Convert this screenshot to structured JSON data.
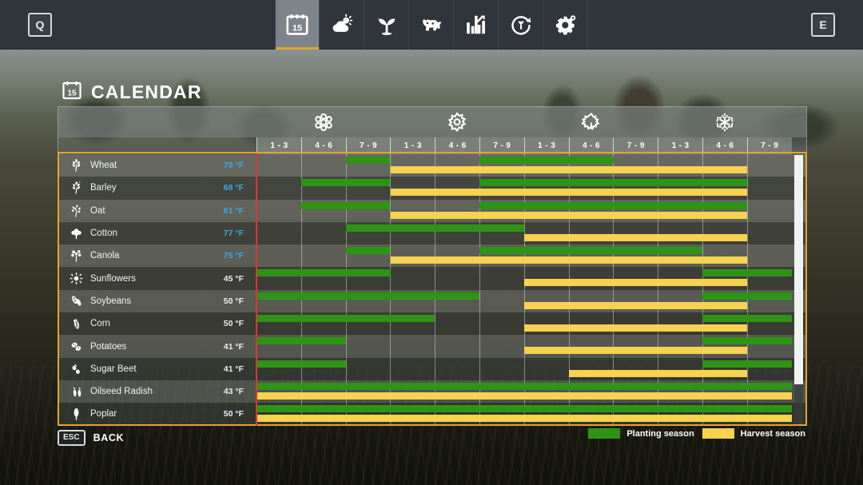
{
  "topbar": {
    "left_key": "Q",
    "right_key": "E",
    "nav": [
      {
        "label": "Calendar",
        "icon": "calendar-icon",
        "active": true
      },
      {
        "label": "Weather",
        "icon": "weather-icon",
        "active": false
      },
      {
        "label": "Crops",
        "icon": "sprout-icon",
        "active": false
      },
      {
        "label": "Animals",
        "icon": "cow-icon",
        "active": false
      },
      {
        "label": "Statistics",
        "icon": "bar-chart-icon",
        "active": false
      },
      {
        "label": "Production",
        "icon": "cycle-icon",
        "active": false
      },
      {
        "label": "Settings",
        "icon": "gear-icon",
        "active": false
      }
    ]
  },
  "page": {
    "title": "CALENDAR",
    "title_icon": "calendar-icon"
  },
  "seasons": [
    {
      "name": "Spring",
      "icon": "blossom-icon"
    },
    {
      "name": "Summer",
      "icon": "sun-icon"
    },
    {
      "name": "Autumn",
      "icon": "leaf-icon"
    },
    {
      "name": "Winter",
      "icon": "snowflake-icon"
    }
  ],
  "periods": [
    "1 - 3",
    "4 - 6",
    "7 - 9",
    "1 - 3",
    "4 - 6",
    "7 - 9",
    "1 - 3",
    "4 - 6",
    "7 - 9",
    "1 - 3",
    "4 - 6",
    "7 - 9"
  ],
  "legend": [
    {
      "label": "Planting season",
      "color": "#2e9415",
      "key": "plant"
    },
    {
      "label": "Harvest season",
      "color": "#f5d24f",
      "key": "harvest"
    }
  ],
  "footer": {
    "back_key": "ESC",
    "back_label": "BACK"
  },
  "colors": {
    "planting": "#2e9415",
    "harvest": "#f5d24f",
    "accent": "#e6a32a",
    "day_marker": "#d63a33",
    "temp_warm": "#39a9e8",
    "temp_cold": "#e9eef0"
  },
  "chart_data": {
    "type": "table",
    "title": "CALENDAR",
    "xlabel": "",
    "ylabel": "",
    "column_count": 12,
    "columns": [
      "1 - 3",
      "4 - 6",
      "7 - 9",
      "1 - 3",
      "4 - 6",
      "7 - 9",
      "1 - 3",
      "4 - 6",
      "7 - 9",
      "1 - 3",
      "4 - 6",
      "7 - 9"
    ],
    "season_groups": [
      "Spring",
      "Summer",
      "Autumn",
      "Winter"
    ],
    "current_period_index": 0,
    "series": [
      {
        "name": "Planting season",
        "color": "#2e9415"
      },
      {
        "name": "Harvest season",
        "color": "#f5d24f"
      }
    ],
    "rows": [
      {
        "crop": "Wheat",
        "icon": "wheat-icon",
        "temp": "79 °F",
        "temp_warm": true,
        "plant": [
          [
            2,
            3
          ],
          [
            5,
            8
          ]
        ],
        "harvest": [
          [
            3,
            11
          ]
        ]
      },
      {
        "crop": "Barley",
        "icon": "barley-icon",
        "temp": "68 °F",
        "temp_warm": true,
        "plant": [
          [
            1,
            3
          ],
          [
            5,
            11
          ]
        ],
        "harvest": [
          [
            3,
            11
          ]
        ]
      },
      {
        "crop": "Oat",
        "icon": "oat-icon",
        "temp": "61 °F",
        "temp_warm": true,
        "plant": [
          [
            1,
            3
          ],
          [
            5,
            11
          ]
        ],
        "harvest": [
          [
            3,
            11
          ]
        ]
      },
      {
        "crop": "Cotton",
        "icon": "cotton-icon",
        "temp": "77 °F",
        "temp_warm": true,
        "plant": [
          [
            2,
            6
          ]
        ],
        "harvest": [
          [
            6,
            11
          ]
        ]
      },
      {
        "crop": "Canola",
        "icon": "canola-icon",
        "temp": "75 °F",
        "temp_warm": true,
        "plant": [
          [
            2,
            3
          ],
          [
            5,
            10
          ]
        ],
        "harvest": [
          [
            3,
            11
          ]
        ]
      },
      {
        "crop": "Sunflowers",
        "icon": "sunflower-icon",
        "temp": "45 °F",
        "temp_warm": false,
        "plant": [
          [
            0,
            3
          ],
          [
            10,
            12
          ]
        ],
        "harvest": [
          [
            6,
            11
          ]
        ]
      },
      {
        "crop": "Soybeans",
        "icon": "soybean-icon",
        "temp": "50 °F",
        "temp_warm": false,
        "plant": [
          [
            0,
            5
          ],
          [
            10,
            12
          ]
        ],
        "harvest": [
          [
            6,
            11
          ]
        ]
      },
      {
        "crop": "Corn",
        "icon": "corn-icon",
        "temp": "50 °F",
        "temp_warm": false,
        "plant": [
          [
            0,
            4
          ],
          [
            10,
            12
          ]
        ],
        "harvest": [
          [
            6,
            11
          ]
        ]
      },
      {
        "crop": "Potatoes",
        "icon": "potato-icon",
        "temp": "41 °F",
        "temp_warm": false,
        "plant": [
          [
            0,
            2
          ],
          [
            10,
            12
          ]
        ],
        "harvest": [
          [
            6,
            11
          ]
        ]
      },
      {
        "crop": "Sugar Beet",
        "icon": "sugarbeet-icon",
        "temp": "41 °F",
        "temp_warm": false,
        "plant": [
          [
            0,
            2
          ],
          [
            10,
            12
          ]
        ],
        "harvest": [
          [
            7,
            11
          ]
        ]
      },
      {
        "crop": "Oilseed Radish",
        "icon": "oilseedradish-icon",
        "temp": "43 °F",
        "temp_warm": false,
        "plant": [
          [
            0,
            12
          ]
        ],
        "harvest": [
          [
            0,
            12
          ]
        ]
      },
      {
        "crop": "Poplar",
        "icon": "poplar-icon",
        "temp": "50 °F",
        "temp_warm": false,
        "plant": [
          [
            0,
            12
          ]
        ],
        "harvest": [
          [
            0,
            12
          ]
        ]
      }
    ]
  }
}
